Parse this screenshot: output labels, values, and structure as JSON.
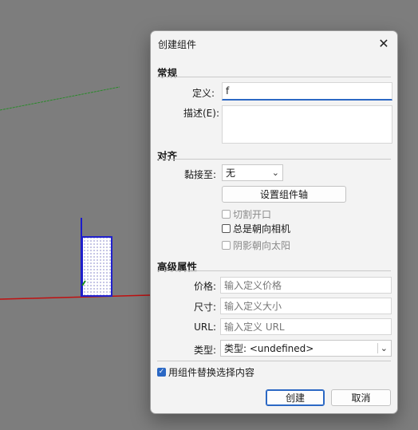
{
  "dialog": {
    "title": "创建组件",
    "close_icon": "close-icon"
  },
  "general": {
    "header": "常规",
    "definition_label": "定义:",
    "definition_value": "f",
    "description_label": "描述(E):",
    "description_value": ""
  },
  "alignment": {
    "header": "对齐",
    "glue_label": "黏接至:",
    "glue_value": "无",
    "set_axes_button": "设置组件轴",
    "cut_opening": {
      "label": "切割开口",
      "checked": false,
      "enabled": false
    },
    "face_camera": {
      "label": "总是朝向相机",
      "checked": false,
      "enabled": true
    },
    "shadows_face_sun": {
      "label": "阴影朝向太阳",
      "checked": false,
      "enabled": false
    }
  },
  "advanced": {
    "header": "高级属性",
    "price_label": "价格:",
    "price_placeholder": "输入定义价格",
    "size_label": "尺寸:",
    "size_placeholder": "输入定义大小",
    "url_label": "URL:",
    "url_placeholder": "输入定义 URL",
    "type_label": "类型:",
    "type_value": "类型: <undefined>"
  },
  "replace_selection": {
    "label": "用组件替换选择内容",
    "checked": true
  },
  "buttons": {
    "create": "创建",
    "cancel": "取消"
  },
  "colors": {
    "accent": "#2b68c4",
    "viewport_bg": "#7d7d7d"
  }
}
